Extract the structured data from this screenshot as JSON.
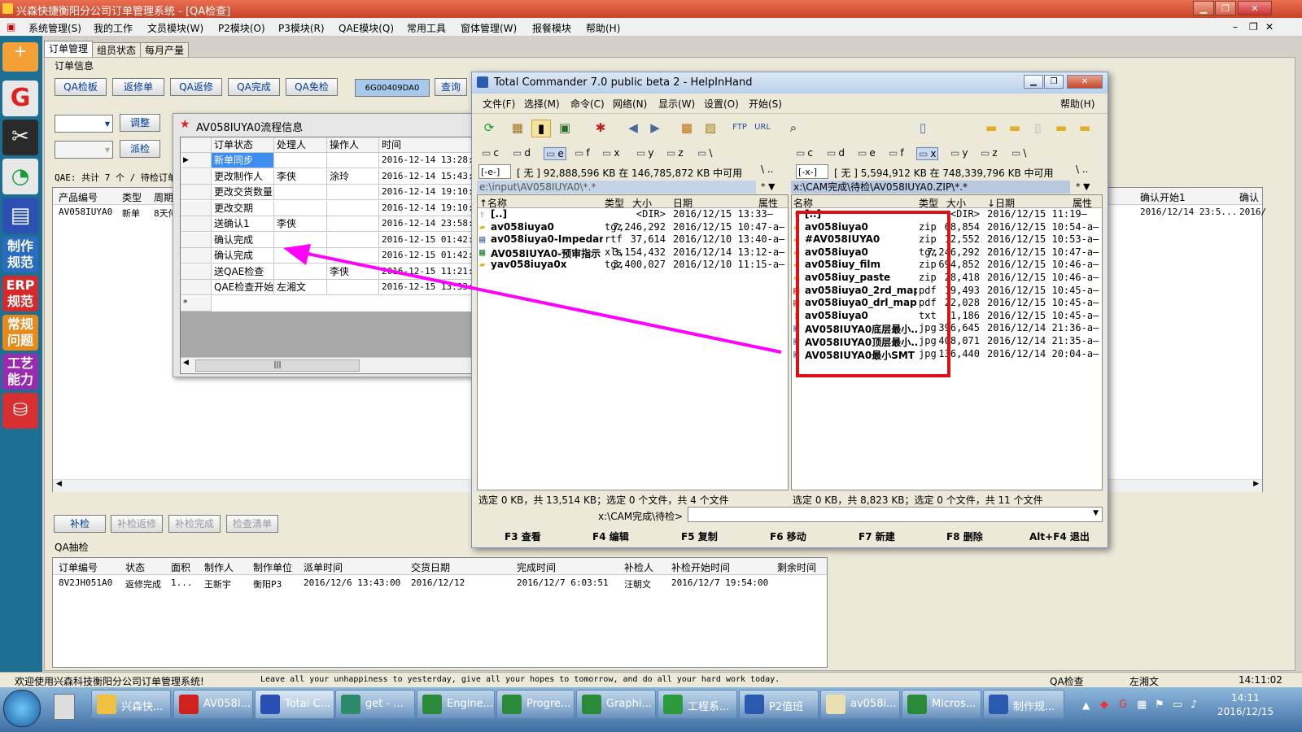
{
  "app": {
    "title": "兴森快捷衡阳分公司订单管理系统 - [QA检查]",
    "menus": [
      "系统管理(S)",
      "我的工作",
      "文员模块(W)",
      "P2模块(O)",
      "P3模块(R)",
      "QAE模块(Q)",
      "常用工具",
      "窗体管理(W)",
      "报餐模块",
      "帮助(H)"
    ]
  },
  "left_toolbar": {
    "labels": [
      "制作规范",
      "ERP规范",
      "常规问题",
      "工艺能力"
    ]
  },
  "tabs": [
    "订单管理",
    "组员状态",
    "每月产量"
  ],
  "order_info": {
    "group_label": "订单信息",
    "buttons": [
      "QA检板",
      "返修单",
      "QA返修",
      "QA完成",
      "QA免检"
    ],
    "order_code": "6G00409DA0",
    "query_label": "查询",
    "adjust_label": "调整",
    "dispatch_label": "派检",
    "qae_summary": "QAE: 共计 7 个 / 待检订单",
    "table_headers": [
      "产品编号",
      "类型",
      "周期",
      "确认开始1",
      "确认"
    ],
    "row": {
      "product": "AV058IUYA0",
      "type": "新单",
      "period": "8天侍",
      "confirm_start": "2016/12/14 23:5...",
      "confirm": "2016/"
    }
  },
  "recheck": {
    "buttons": [
      "补检",
      "补检返修",
      "补检完成",
      "检查清单"
    ]
  },
  "qa_sampling": {
    "label": "QA抽检",
    "headers": [
      "订单编号",
      "状态",
      "面积",
      "制作人",
      "制作单位",
      "派单时间",
      "交货日期",
      "完成时间",
      "补检人",
      "补检开始时间",
      "剩余时间"
    ],
    "row": [
      "8V2JH051A0",
      "返修完成",
      "1...",
      "王新宇",
      "衡阳P3",
      "2016/12/6 13:43:00",
      "2016/12/12",
      "2016/12/7 6:03:51",
      "汪朝文",
      "2016/12/7 19:54:00",
      ""
    ]
  },
  "flow_window": {
    "title": "AV058IUYA0流程信息",
    "headers": [
      "订单状态",
      "处理人",
      "操作人",
      "时间"
    ],
    "rows": [
      [
        "新单同步",
        "",
        "",
        "2016-12-14 13:28:43"
      ],
      [
        "更改制作人",
        "李侠",
        "涂玲",
        "2016-12-14 15:43:35"
      ],
      [
        "更改交货数量",
        "",
        "",
        "2016-12-14 19:10:07"
      ],
      [
        "更改交期",
        "",
        "",
        "2016-12-14 19:10:07"
      ],
      [
        "送确认1",
        "李侠",
        "",
        "2016-12-14 23:58:29"
      ],
      [
        "确认完成",
        "",
        "",
        "2016-12-15 01:42:21"
      ],
      [
        "确认完成",
        "",
        "",
        "2016-12-15 01:42:23"
      ],
      [
        "送QAE检查",
        "",
        "李侠",
        "2016-12-15 11:21:48"
      ],
      [
        "QAE检查开始",
        "左湘文",
        "",
        "2016-12-15 13:33:03"
      ]
    ],
    "new_row_marker": "*",
    "current_marker": "▶",
    "scroll_grip": "|||"
  },
  "tc": {
    "title": "Total Commander 7.0 public beta 2 - HelpInHand",
    "menus": [
      "文件(F)",
      "选择(M)",
      "命令(C)",
      "网络(N)",
      "显示(W)",
      "设置(O)",
      "开始(S)"
    ],
    "help": "帮助(H)",
    "drives": [
      "c",
      "d",
      "e",
      "f",
      "x",
      "y",
      "z",
      "\\"
    ],
    "left": {
      "drive": "[-e-]",
      "space": "[ 无 ]  92,888,596 KB 在 146,785,872 KB 中可用",
      "path": "e:\\input\\AV058IUYA0\\*.*",
      "headers": [
        "↑名称",
        "类型",
        "大小",
        "日期",
        "属性"
      ],
      "files": [
        [
          "[..]",
          "",
          "<DIR>",
          "2016/12/15 13:33—"
        ],
        [
          "av058iuya0",
          "tgz",
          "7,246,292",
          "2016/12/15 10:47-a–"
        ],
        [
          "av058iuya0-Impedanc..",
          "rtf",
          "37,614",
          "2016/12/10 13:40-a–"
        ],
        [
          "AV058IUYA0-预审指示",
          "xls",
          "3,154,432",
          "2016/12/14 13:12-a–"
        ],
        [
          "yav058iuya0x",
          "tgz",
          "3,400,027",
          "2016/12/10 11:15-a–"
        ]
      ],
      "status": "选定 0 KB，共 13,514 KB；选定 0 个文件，共 4 个文件"
    },
    "right": {
      "drive": "[-x-]",
      "space": "[ 无 ]  5,594,912 KB 在 748,339,796 KB 中可用",
      "path": "x:\\CAM完成\\待检\\AV058IUYA0.ZIP\\*.*",
      "headers": [
        "名称",
        "类型",
        "大小",
        "↓日期",
        "属性"
      ],
      "files": [
        [
          "[..]",
          "",
          "<DIR>",
          "2016/12/15 11:19—"
        ],
        [
          "av058iuya0",
          "zip",
          "68,854",
          "2016/12/15 10:54-a–"
        ],
        [
          "#AV058IUYA0",
          "zip",
          "12,552",
          "2016/12/15 10:53-a–"
        ],
        [
          "av058iuya0",
          "tgz",
          "7,246,292",
          "2016/12/15 10:47-a–"
        ],
        [
          "av058iuy_film",
          "zip",
          "694,852",
          "2016/12/15 10:46-a–"
        ],
        [
          "av058iuy_paste",
          "zip",
          "28,418",
          "2016/12/15 10:46-a–"
        ],
        [
          "av058iuya0_2rd_map",
          "pdf",
          "19,493",
          "2016/12/15 10:45-a–"
        ],
        [
          "av058iuya0_drl_map",
          "pdf",
          "22,028",
          "2016/12/15 10:45-a–"
        ],
        [
          "av058iuya0",
          "txt",
          "1,186",
          "2016/12/15 10:45-a–"
        ],
        [
          "AV058IUYA0底层最小..",
          "jpg",
          "396,645",
          "2016/12/14 21:36-a–"
        ],
        [
          "AV058IUYA0顶层最小..",
          "jpg",
          "408,071",
          "2016/12/14 21:35-a–"
        ],
        [
          "AV058IUYA0最小SMT",
          "jpg",
          "136,440",
          "2016/12/14 20:04-a–"
        ]
      ],
      "status": "选定 0 KB，共 8,823 KB；选定 0 个文件，共 11 个文件"
    },
    "cmd_path": "x:\\CAM完成\\待检>",
    "fkeys": [
      "F3 查看",
      "F4 编辑",
      "F5 复制",
      "F6 移动",
      "F7 新建",
      "F8 删除",
      "Alt+F4 退出"
    ]
  },
  "status_bar": {
    "welcome": "欢迎使用兴森科技衡阳分公司订单管理系统!",
    "motto": "Leave all your unhappiness to yesterday, give all your hopes to tomorrow, and do all your hard work today.",
    "module": "QA检查",
    "user": "左湘文",
    "time": "14:11:02"
  },
  "taskbar": {
    "items": [
      "兴森快...",
      "AV058I...",
      "Total C...",
      "get - ...",
      "Engine...",
      "Progre...",
      "Graphi...",
      "工程系...",
      "P2值班",
      "av058i...",
      "Micros...",
      "制作规..."
    ],
    "clock_time": "14:11",
    "clock_date": "2016/12/15"
  },
  "colors": {
    "annotation_arrow": "#ff00ff",
    "highlight_box": "#e01010",
    "titlebar": "#d9553a",
    "taskbar": "#3d6ea4"
  }
}
